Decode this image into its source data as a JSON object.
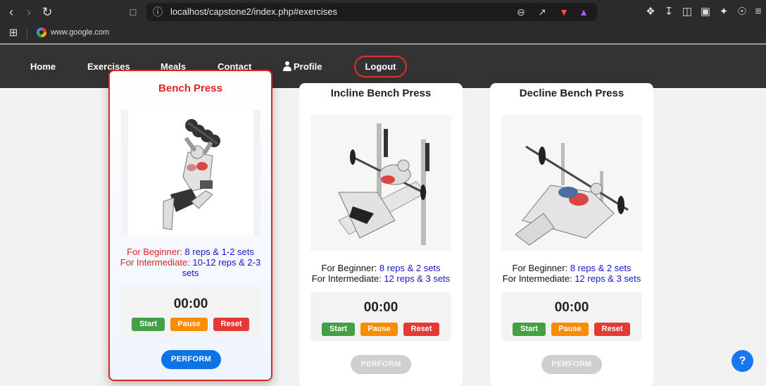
{
  "browser": {
    "url": "localhost/capstone2/index.php#exercises",
    "bookmark": "www.google.com"
  },
  "nav": {
    "home": "Home",
    "exercises": "Exercises",
    "meals": "Meals",
    "contact": "Contact",
    "profile": "Profile",
    "logout": "Logout"
  },
  "cards": [
    {
      "title": "Bench Press",
      "beginner_label": "For Beginner:",
      "beginner_value": "8 reps & 1-2 sets",
      "intermediate_label": "For Intermediate:",
      "intermediate_value": "10-12 reps & 2-3 sets",
      "timer": "00:00",
      "start": "Start",
      "pause": "Pause",
      "reset": "Reset",
      "perform": "PERFORM"
    },
    {
      "title": "Incline Bench Press",
      "beginner_label": "For Beginner:",
      "beginner_value": "8 reps & 2 sets",
      "intermediate_label": "For Intermediate:",
      "intermediate_value": "12 reps & 3 sets",
      "timer": "00:00",
      "start": "Start",
      "pause": "Pause",
      "reset": "Reset",
      "perform": "PERFORM"
    },
    {
      "title": "Decline Bench Press",
      "beginner_label": "For Beginner:",
      "beginner_value": "8 reps & 2 sets",
      "intermediate_label": "For Intermediate:",
      "intermediate_value": "12 reps & 3 sets",
      "timer": "00:00",
      "start": "Start",
      "pause": "Pause",
      "reset": "Reset",
      "perform": "PERFORM"
    }
  ],
  "help": "?",
  "colors": {
    "accent_red": "#dc2626",
    "value_blue": "#1515c8",
    "perform_blue": "#0d73e8",
    "start_green": "#43a047",
    "pause_orange": "#fb8c00",
    "reset_red": "#e53935"
  }
}
